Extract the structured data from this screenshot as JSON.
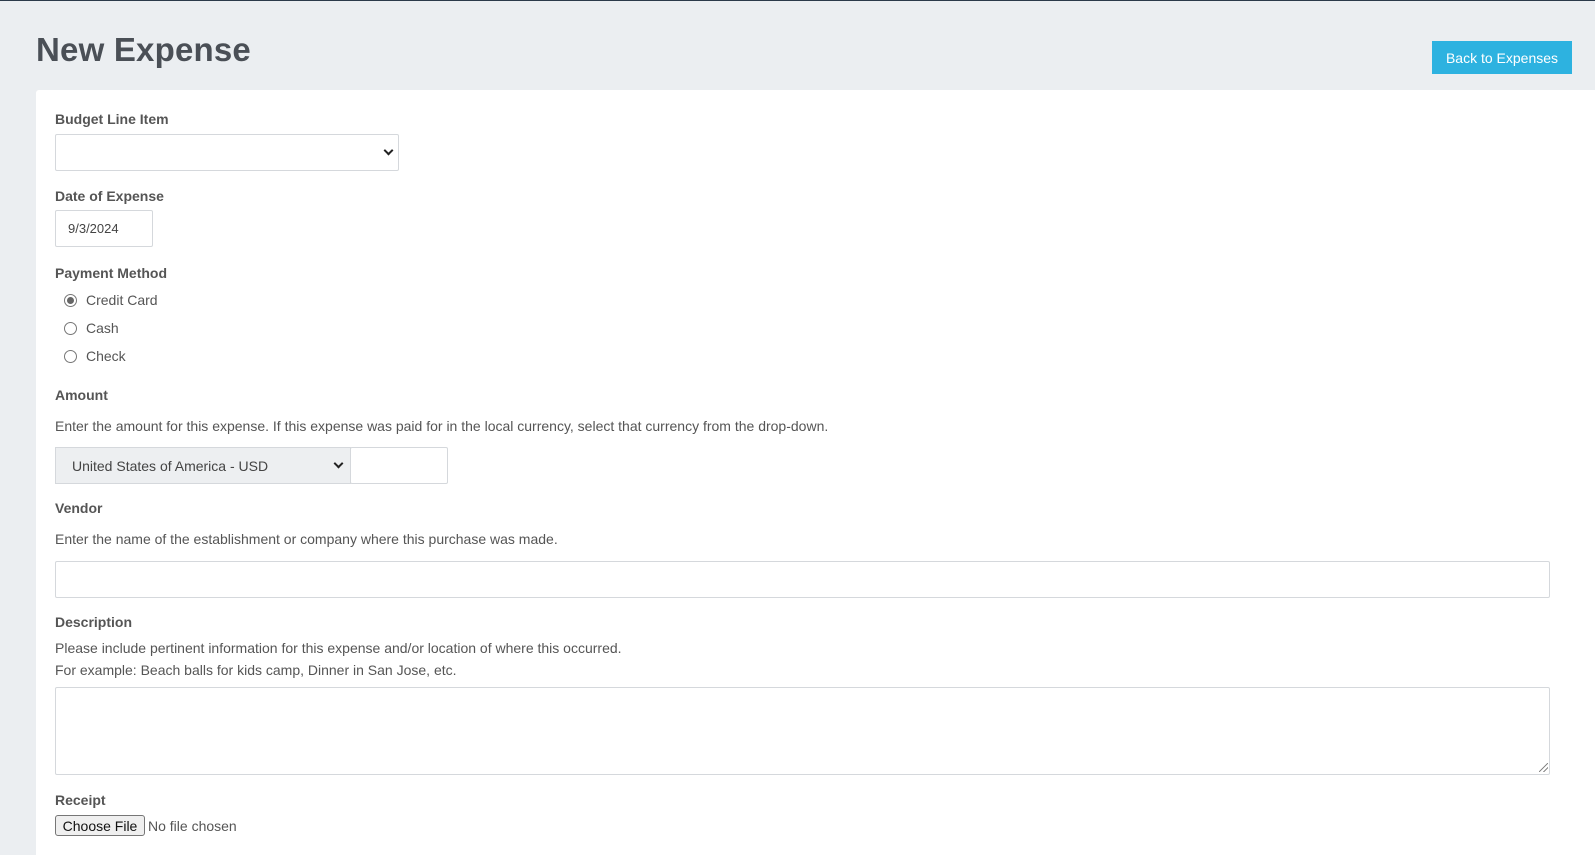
{
  "page": {
    "title": "New Expense",
    "back_label": "Back to Expenses"
  },
  "budget": {
    "label": "Budget Line Item",
    "value": ""
  },
  "date": {
    "label": "Date of Expense",
    "value": "9/3/2024"
  },
  "payment": {
    "label": "Payment Method",
    "options": [
      "Credit Card",
      "Cash",
      "Check"
    ],
    "selected": "Credit Card"
  },
  "amount": {
    "label": "Amount",
    "help": "Enter the amount for this expense. If this expense was paid for in the local currency, select that currency from the drop-down.",
    "currency": "United States of America - USD",
    "value": ""
  },
  "vendor": {
    "label": "Vendor",
    "help": "Enter the name of the establishment or company where this purchase was made.",
    "value": ""
  },
  "description": {
    "label": "Description",
    "help_line1": "Please include pertinent information for this expense and/or location of where this occurred.",
    "help_line2": "For example: Beach balls for kids camp, Dinner in San Jose, etc.",
    "value": ""
  },
  "receipt": {
    "label": "Receipt",
    "button_label": "Choose File",
    "status": "No file chosen"
  },
  "icons": {
    "dropdown": "chevron-down-icon",
    "radio_selected": "radio-checked-icon",
    "resize": "resize-grip-icon"
  }
}
